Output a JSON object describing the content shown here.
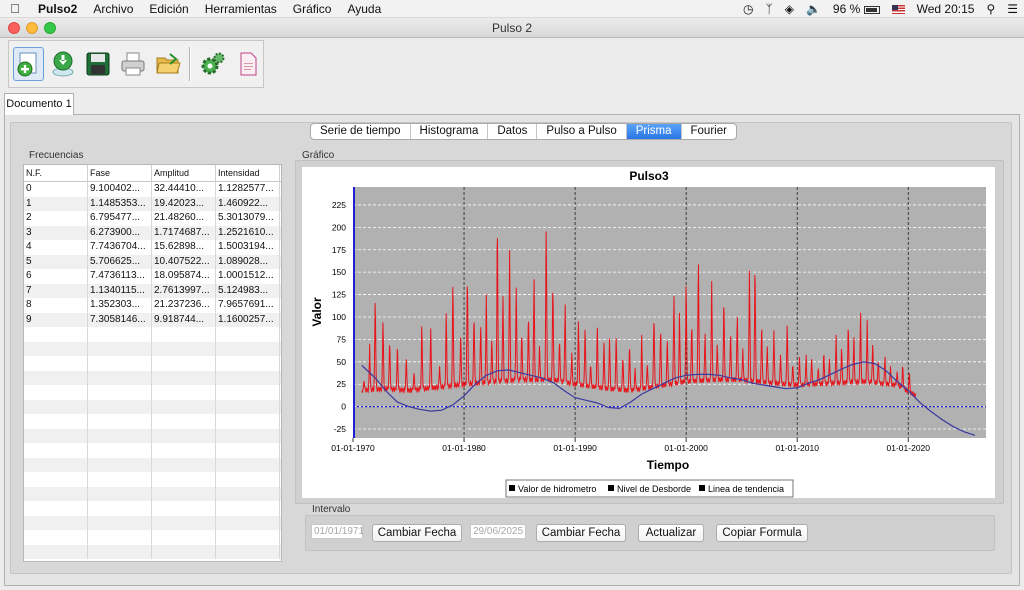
{
  "menubar": {
    "app_name": "Pulso2",
    "items": [
      "Archivo",
      "Edición",
      "Herramientas",
      "Gráfico",
      "Ayuda"
    ],
    "battery": "96 %",
    "clock": "Wed 20:15"
  },
  "window": {
    "title": "Pulso 2"
  },
  "toolbar": {
    "buttons": [
      "new-document-icon",
      "download-icon",
      "save-icon",
      "print-icon",
      "open-folder-icon",
      "settings-gears-icon",
      "document-icon"
    ]
  },
  "document_tab": {
    "label": "Documento 1"
  },
  "view_tabs": {
    "items": [
      "Serie de tiempo",
      "Histograma",
      "Datos",
      "Pulso a Pulso",
      "Prisma",
      "Fourier"
    ],
    "selected": "Prisma"
  },
  "frequencies": {
    "group_label": "Frecuencias",
    "headers": [
      "N.F.",
      "Fase",
      "Amplitud",
      "Intensidad"
    ],
    "rows": [
      [
        "0",
        "9.100402...",
        "32.44410...",
        "1.1282577..."
      ],
      [
        "1",
        "1.1485353...",
        "19.42023...",
        "1.460922..."
      ],
      [
        "2",
        "6.795477...",
        "21.48260...",
        "5.3013079..."
      ],
      [
        "3",
        "6.273900...",
        "1.7174687...",
        "1.2521610..."
      ],
      [
        "4",
        "7.7436704...",
        "15.62898...",
        "1.5003194..."
      ],
      [
        "5",
        "5.706625...",
        "10.407522...",
        "1.089028..."
      ],
      [
        "6",
        "7.4736113...",
        "18.095874...",
        "1.0001512..."
      ],
      [
        "7",
        "1.1340115...",
        "2.7613997...",
        "5.124983..."
      ],
      [
        "8",
        "1.352303...",
        "21.237236...",
        "7.9657691..."
      ],
      [
        "9",
        "7.3058146...",
        "9.918744...",
        "1.1600257..."
      ]
    ]
  },
  "chart_group_label": "Gráfico",
  "chart_data": {
    "type": "line",
    "title": "Pulso3",
    "xlabel": "Tiempo",
    "ylabel": "Valor",
    "x_tick_labels": [
      "01-01-1970",
      "01-01-1980",
      "01-01-1990",
      "01-01-2000",
      "01-01-2010",
      "01-01-2020"
    ],
    "x_ticks_year": [
      1970,
      1980,
      1990,
      2000,
      2010,
      2020
    ],
    "xlim_year": [
      1970,
      2027
    ],
    "y_ticks": [
      -25,
      0,
      25,
      50,
      75,
      100,
      125,
      150,
      175,
      200,
      225
    ],
    "ylim": [
      -35,
      245
    ],
    "grid": true,
    "legend_position": "bottom",
    "series": [
      {
        "name": "Valor de hidrometro",
        "color": "#e8141c",
        "baseline": [
          [
            1970.8,
            18
          ],
          [
            1973,
            20
          ],
          [
            1975,
            18
          ],
          [
            1978,
            22
          ],
          [
            1980,
            25
          ],
          [
            1982,
            27
          ],
          [
            1985,
            30
          ],
          [
            1988,
            30
          ],
          [
            1990,
            25
          ],
          [
            1993,
            20
          ],
          [
            1995,
            18
          ],
          [
            1998,
            24
          ],
          [
            2000,
            28
          ],
          [
            2003,
            30
          ],
          [
            2005,
            30
          ],
          [
            2008,
            26
          ],
          [
            2010,
            24
          ],
          [
            2013,
            26
          ],
          [
            2016,
            28
          ],
          [
            2019,
            24
          ],
          [
            2020.7,
            12
          ]
        ],
        "peaks": [
          [
            1971.0,
            30
          ],
          [
            1971.5,
            70
          ],
          [
            1972.0,
            130
          ],
          [
            1972.7,
            105
          ],
          [
            1973.3,
            80
          ],
          [
            1974.0,
            75
          ],
          [
            1974.8,
            58
          ],
          [
            1975.5,
            40
          ],
          [
            1976.2,
            100
          ],
          [
            1977.0,
            92
          ],
          [
            1977.8,
            45
          ],
          [
            1978.4,
            110
          ],
          [
            1979.0,
            150
          ],
          [
            1979.7,
            85
          ],
          [
            1980.3,
            160
          ],
          [
            1980.9,
            110
          ],
          [
            1981.5,
            98
          ],
          [
            1982.0,
            125
          ],
          [
            1982.5,
            80
          ],
          [
            1983.0,
            226
          ],
          [
            1983.5,
            130
          ],
          [
            1984.1,
            175
          ],
          [
            1984.7,
            140
          ],
          [
            1985.2,
            88
          ],
          [
            1985.8,
            110
          ],
          [
            1986.3,
            150
          ],
          [
            1986.8,
            70
          ],
          [
            1987.4,
            220
          ],
          [
            1988.0,
            150
          ],
          [
            1988.6,
            80
          ],
          [
            1989.1,
            120
          ],
          [
            1989.7,
            60
          ],
          [
            1990.3,
            100
          ],
          [
            1990.9,
            95
          ],
          [
            1991.4,
            50
          ],
          [
            1992.0,
            98
          ],
          [
            1992.6,
            75
          ],
          [
            1993.1,
            80
          ],
          [
            1993.7,
            85
          ],
          [
            1994.3,
            60
          ],
          [
            1994.9,
            75
          ],
          [
            1995.4,
            45
          ],
          [
            1996.0,
            80
          ],
          [
            1996.5,
            50
          ],
          [
            1997.1,
            110
          ],
          [
            1997.7,
            95
          ],
          [
            1998.3,
            80
          ],
          [
            1998.9,
            130
          ],
          [
            1999.4,
            110
          ],
          [
            2000.0,
            150
          ],
          [
            2000.5,
            100
          ],
          [
            2001.1,
            178
          ],
          [
            2001.7,
            85
          ],
          [
            2002.3,
            140
          ],
          [
            2002.8,
            75
          ],
          [
            2003.4,
            130
          ],
          [
            2004.0,
            90
          ],
          [
            2004.6,
            110
          ],
          [
            2005.1,
            65
          ],
          [
            2005.7,
            160
          ],
          [
            2006.2,
            175
          ],
          [
            2006.8,
            100
          ],
          [
            2007.3,
            70
          ],
          [
            2007.9,
            85
          ],
          [
            2008.5,
            60
          ],
          [
            2009.1,
            100
          ],
          [
            2009.6,
            50
          ],
          [
            2010.2,
            60
          ],
          [
            2010.8,
            60
          ],
          [
            2011.3,
            55
          ],
          [
            2011.9,
            45
          ],
          [
            2012.4,
            65
          ],
          [
            2012.9,
            55
          ],
          [
            2013.5,
            80
          ],
          [
            2014.0,
            70
          ],
          [
            2014.6,
            100
          ],
          [
            2015.1,
            85
          ],
          [
            2015.7,
            110
          ],
          [
            2016.3,
            97
          ],
          [
            2016.8,
            75
          ],
          [
            2017.3,
            55
          ],
          [
            2017.9,
            60
          ],
          [
            2018.4,
            45
          ],
          [
            2019.0,
            40
          ],
          [
            2019.5,
            50
          ],
          [
            2020.1,
            42
          ]
        ]
      },
      {
        "name": "Nivel de Desborde",
        "color": "#1f1fd8",
        "value": 0
      },
      {
        "name": "Linea de tendencia",
        "color": "#3a3aa0",
        "points": [
          [
            1970.8,
            46
          ],
          [
            1972,
            32
          ],
          [
            1973,
            17
          ],
          [
            1974,
            5
          ],
          [
            1975,
            0
          ],
          [
            1976,
            -3
          ],
          [
            1977,
            -5
          ],
          [
            1978,
            -4
          ],
          [
            1979,
            2
          ],
          [
            1980,
            12
          ],
          [
            1981,
            25
          ],
          [
            1982,
            35
          ],
          [
            1983,
            40
          ],
          [
            1984,
            41
          ],
          [
            1985,
            38
          ],
          [
            1986,
            35
          ],
          [
            1987,
            32
          ],
          [
            1988,
            27
          ],
          [
            1989,
            18
          ],
          [
            1990,
            10
          ],
          [
            1991,
            7
          ],
          [
            1992,
            4
          ],
          [
            1993,
            -1
          ],
          [
            1994,
            -2
          ],
          [
            1995,
            5
          ],
          [
            1996,
            14
          ],
          [
            1997,
            20
          ],
          [
            1998,
            26
          ],
          [
            1999,
            32
          ],
          [
            2000,
            35
          ],
          [
            2001,
            36
          ],
          [
            2002,
            36
          ],
          [
            2003,
            35
          ],
          [
            2004,
            32
          ],
          [
            2005,
            30
          ],
          [
            2006,
            26
          ],
          [
            2007,
            24
          ],
          [
            2008,
            22
          ],
          [
            2009,
            20
          ],
          [
            2010,
            21
          ],
          [
            2011,
            26
          ],
          [
            2012,
            30
          ],
          [
            2013,
            36
          ],
          [
            2014,
            42
          ],
          [
            2015,
            47
          ],
          [
            2016,
            50
          ],
          [
            2017,
            48
          ],
          [
            2018,
            40
          ],
          [
            2019,
            28
          ],
          [
            2020,
            18
          ],
          [
            2021,
            5
          ],
          [
            2022,
            -5
          ],
          [
            2023,
            -14
          ],
          [
            2024,
            -22
          ],
          [
            2025,
            -28
          ],
          [
            2026,
            -32
          ]
        ]
      }
    ]
  },
  "interval": {
    "group_label": "Intervalo",
    "start_date": "01/01/1971",
    "end_date": "29/06/2025",
    "change_date_label": "Cambiar Fecha",
    "update_label": "Actualizar",
    "copy_formula_label": "Copiar Formula"
  }
}
